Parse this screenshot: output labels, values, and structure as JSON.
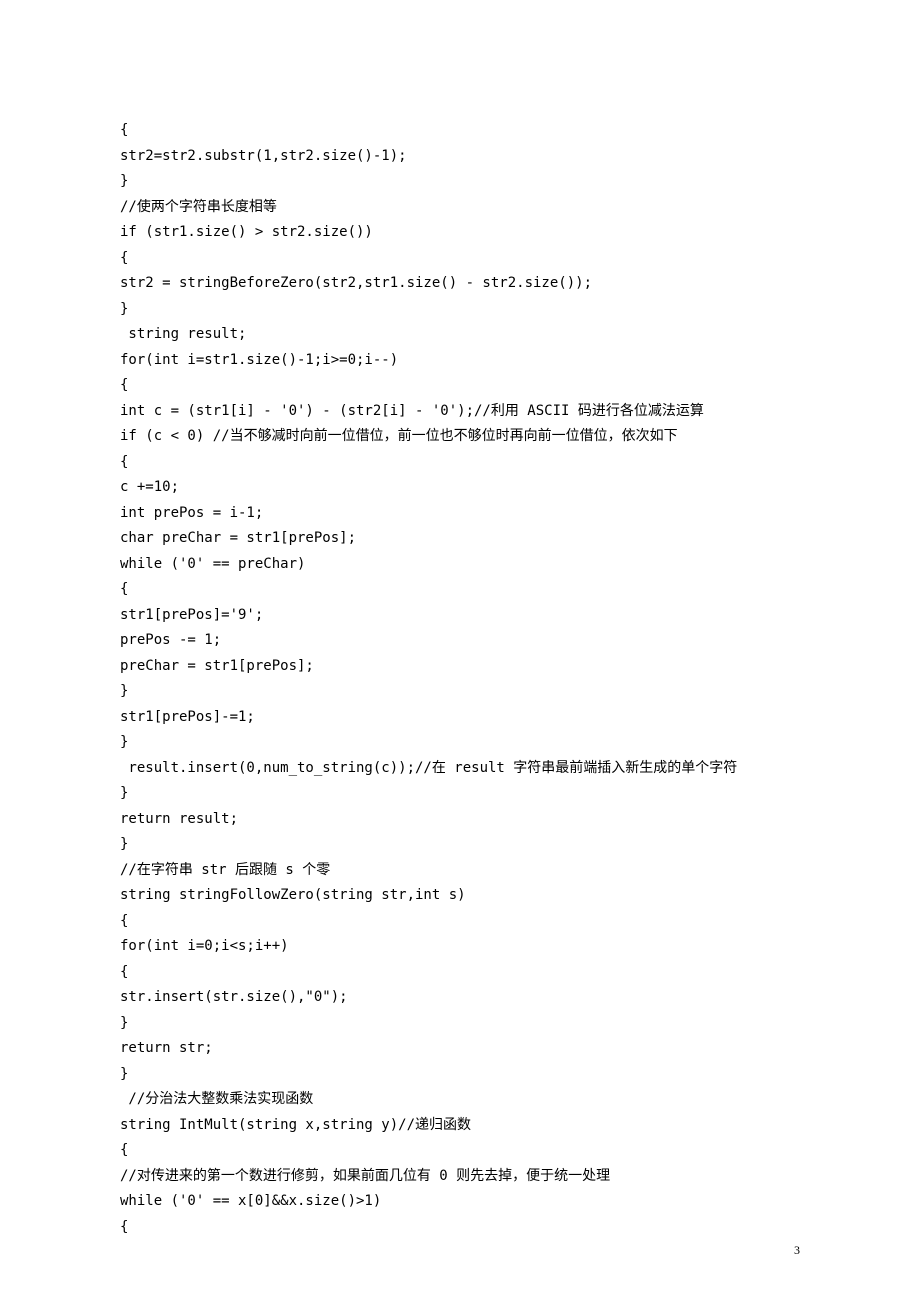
{
  "page_number": "3",
  "lines": [
    "{",
    "str2=str2.substr(1,str2.size()-1);",
    "}",
    "//使两个字符串长度相等",
    "if (str1.size() > str2.size())",
    "{",
    "str2 = stringBeforeZero(str2,str1.size() - str2.size());",
    "}",
    " string result;",
    "for(int i=str1.size()-1;i>=0;i--)",
    "{",
    "int c = (str1[i] - '0') - (str2[i] - '0');//利用 ASCII 码进行各位减法运算",
    "if (c < 0) //当不够减时向前一位借位，前一位也不够位时再向前一位借位，依次如下",
    "{",
    "c +=10;",
    "int prePos = i-1;",
    "char preChar = str1[prePos];",
    "while ('0' == preChar)",
    "{",
    "str1[prePos]='9';",
    "prePos -= 1;",
    "preChar = str1[prePos];",
    "}",
    "str1[prePos]-=1;",
    "}",
    " result.insert(0,num_to_string(c));//在 result 字符串最前端插入新生成的单个字符",
    "}",
    "return result;",
    "}",
    "//在字符串 str 后跟随 s 个零",
    "string stringFollowZero(string str,int s)",
    "{",
    "for(int i=0;i<s;i++)",
    "{",
    "str.insert(str.size(),\"0\");",
    "}",
    "return str;",
    "}",
    " //分治法大整数乘法实现函数",
    "string IntMult(string x,string y)//递归函数",
    "{",
    "//对传进来的第一个数进行修剪，如果前面几位有 0 则先去掉，便于统一处理",
    "while ('0' == x[0]&&x.size()>1)",
    "{"
  ]
}
